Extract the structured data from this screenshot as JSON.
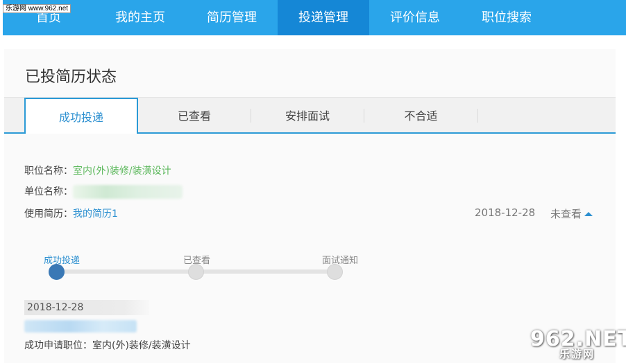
{
  "watermark_top": "乐游网 www.962.net",
  "nav": {
    "items": [
      {
        "label": "首页"
      },
      {
        "label": "我的主页"
      },
      {
        "label": "简历管理"
      },
      {
        "label": "投递管理"
      },
      {
        "label": "评价信息"
      },
      {
        "label": "职位搜索"
      }
    ],
    "active_index": 3
  },
  "panel": {
    "title": "已投简历状态",
    "tabs": [
      "成功投递",
      "已查看",
      "安排面试",
      "不合适"
    ],
    "active_tab": 0
  },
  "application": {
    "position_label": "职位名称：",
    "position_value": "室内(外)装修/装潢设计",
    "company_label": "单位名称：",
    "resume_label": "使用简历：",
    "resume_value": "我的简历1",
    "date": "2018-12-28",
    "status": "未查看"
  },
  "progress": {
    "steps": [
      {
        "label": "成功投递",
        "done": true
      },
      {
        "label": "已查看",
        "done": false
      },
      {
        "label": "面试通知",
        "done": false
      }
    ]
  },
  "log": {
    "date": "2018-12-28",
    "description": "成功申请职位：室内(外)装修/装潢设计"
  },
  "logo": {
    "big": "962.NET",
    "small": "乐游网"
  },
  "colors": {
    "nav_bg": "#2aa5ea",
    "nav_active": "#1587d6",
    "accent": "#2b8fd0",
    "green": "#5cb85c",
    "step_done": "#3a78b5"
  }
}
